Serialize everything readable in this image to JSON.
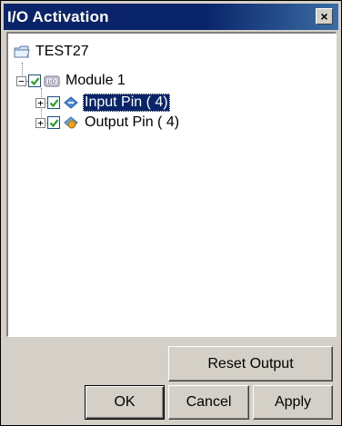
{
  "window": {
    "title": "I/O Activation",
    "close_glyph": "×"
  },
  "tree": {
    "root": {
      "label": "TEST27",
      "icon": "folder-icon"
    },
    "module": {
      "label": "Module 1",
      "checked": true,
      "expanded": true,
      "expander": "−",
      "icon": "io-module-icon"
    },
    "children": [
      {
        "label": "Input Pin ( 4)",
        "checked": true,
        "expander": "+",
        "selected": true,
        "icon": "input-pin-icon"
      },
      {
        "label": "Output Pin ( 4)",
        "checked": true,
        "expander": "+",
        "selected": false,
        "icon": "output-pin-icon"
      }
    ]
  },
  "buttons": {
    "reset_output": "Reset Output",
    "ok": "OK",
    "cancel": "Cancel",
    "apply": "Apply"
  },
  "colors": {
    "titlebar": "#0a246a",
    "dialog_face": "#d4d0c8",
    "selection": "#0a246a",
    "check": "#21a121"
  }
}
